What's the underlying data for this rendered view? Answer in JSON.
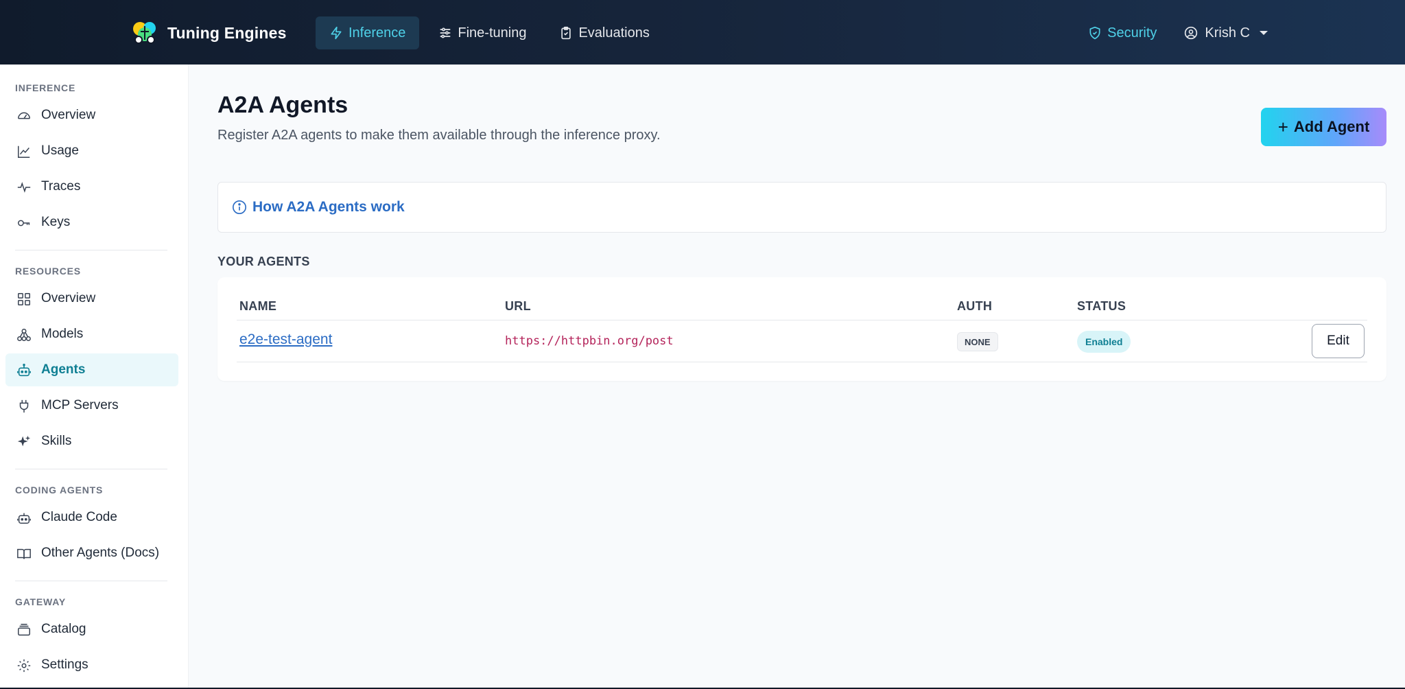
{
  "brand": {
    "name": "Tuning Engines"
  },
  "topnav": {
    "items": [
      {
        "label": "Inference",
        "icon": "bolt-icon",
        "active": true
      },
      {
        "label": "Fine-tuning",
        "icon": "sliders-icon",
        "active": false
      },
      {
        "label": "Evaluations",
        "icon": "clipboard-icon",
        "active": false
      }
    ],
    "security": "Security",
    "user": "Krish C"
  },
  "sidebar": {
    "sections": [
      {
        "label": "INFERENCE",
        "items": [
          {
            "label": "Overview",
            "icon": "gauge-icon"
          },
          {
            "label": "Usage",
            "icon": "line-chart-icon"
          },
          {
            "label": "Traces",
            "icon": "activity-icon"
          },
          {
            "label": "Keys",
            "icon": "key-icon"
          }
        ]
      },
      {
        "label": "RESOURCES",
        "items": [
          {
            "label": "Overview",
            "icon": "grid-icon"
          },
          {
            "label": "Models",
            "icon": "network-icon"
          },
          {
            "label": "Agents",
            "icon": "bot-icon",
            "active": true
          },
          {
            "label": "MCP Servers",
            "icon": "plug-icon"
          },
          {
            "label": "Skills",
            "icon": "sparkles-icon"
          }
        ]
      },
      {
        "label": "CODING AGENTS",
        "items": [
          {
            "label": "Claude Code",
            "icon": "bot-icon"
          },
          {
            "label": "Other Agents (Docs)",
            "icon": "book-icon"
          }
        ]
      },
      {
        "label": "GATEWAY",
        "items": [
          {
            "label": "Catalog",
            "icon": "layers-icon"
          },
          {
            "label": "Settings",
            "icon": "gear-icon"
          }
        ]
      }
    ]
  },
  "main": {
    "title": "A2A Agents",
    "subtitle": "Register A2A agents to make them available through the inference proxy.",
    "add_button": "Add Agent",
    "howto": "How A2A Agents work",
    "section_title": "YOUR AGENTS",
    "table": {
      "headers": {
        "name": "NAME",
        "url": "URL",
        "auth": "AUTH",
        "status": "STATUS"
      },
      "rows": [
        {
          "name": "e2e-test-agent",
          "url": "https://httpbin.org/post",
          "auth": "NONE",
          "status": "Enabled",
          "action": "Edit"
        }
      ]
    }
  },
  "colors": {
    "accent": "#22d3ee",
    "link": "#2b6cc4",
    "nav_bg": "#101b2c"
  }
}
